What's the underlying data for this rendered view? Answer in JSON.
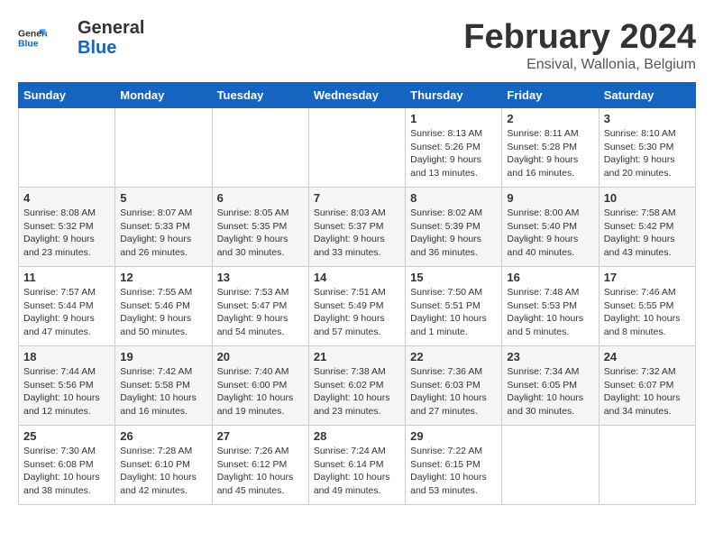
{
  "header": {
    "logo_general": "General",
    "logo_blue": "Blue",
    "month_title": "February 2024",
    "location": "Ensival, Wallonia, Belgium"
  },
  "weekdays": [
    "Sunday",
    "Monday",
    "Tuesday",
    "Wednesday",
    "Thursday",
    "Friday",
    "Saturday"
  ],
  "weeks": [
    [
      {
        "day": "",
        "info": ""
      },
      {
        "day": "",
        "info": ""
      },
      {
        "day": "",
        "info": ""
      },
      {
        "day": "",
        "info": ""
      },
      {
        "day": "1",
        "info": "Sunrise: 8:13 AM\nSunset: 5:26 PM\nDaylight: 9 hours\nand 13 minutes."
      },
      {
        "day": "2",
        "info": "Sunrise: 8:11 AM\nSunset: 5:28 PM\nDaylight: 9 hours\nand 16 minutes."
      },
      {
        "day": "3",
        "info": "Sunrise: 8:10 AM\nSunset: 5:30 PM\nDaylight: 9 hours\nand 20 minutes."
      }
    ],
    [
      {
        "day": "4",
        "info": "Sunrise: 8:08 AM\nSunset: 5:32 PM\nDaylight: 9 hours\nand 23 minutes."
      },
      {
        "day": "5",
        "info": "Sunrise: 8:07 AM\nSunset: 5:33 PM\nDaylight: 9 hours\nand 26 minutes."
      },
      {
        "day": "6",
        "info": "Sunrise: 8:05 AM\nSunset: 5:35 PM\nDaylight: 9 hours\nand 30 minutes."
      },
      {
        "day": "7",
        "info": "Sunrise: 8:03 AM\nSunset: 5:37 PM\nDaylight: 9 hours\nand 33 minutes."
      },
      {
        "day": "8",
        "info": "Sunrise: 8:02 AM\nSunset: 5:39 PM\nDaylight: 9 hours\nand 36 minutes."
      },
      {
        "day": "9",
        "info": "Sunrise: 8:00 AM\nSunset: 5:40 PM\nDaylight: 9 hours\nand 40 minutes."
      },
      {
        "day": "10",
        "info": "Sunrise: 7:58 AM\nSunset: 5:42 PM\nDaylight: 9 hours\nand 43 minutes."
      }
    ],
    [
      {
        "day": "11",
        "info": "Sunrise: 7:57 AM\nSunset: 5:44 PM\nDaylight: 9 hours\nand 47 minutes."
      },
      {
        "day": "12",
        "info": "Sunrise: 7:55 AM\nSunset: 5:46 PM\nDaylight: 9 hours\nand 50 minutes."
      },
      {
        "day": "13",
        "info": "Sunrise: 7:53 AM\nSunset: 5:47 PM\nDaylight: 9 hours\nand 54 minutes."
      },
      {
        "day": "14",
        "info": "Sunrise: 7:51 AM\nSunset: 5:49 PM\nDaylight: 9 hours\nand 57 minutes."
      },
      {
        "day": "15",
        "info": "Sunrise: 7:50 AM\nSunset: 5:51 PM\nDaylight: 10 hours\nand 1 minute."
      },
      {
        "day": "16",
        "info": "Sunrise: 7:48 AM\nSunset: 5:53 PM\nDaylight: 10 hours\nand 5 minutes."
      },
      {
        "day": "17",
        "info": "Sunrise: 7:46 AM\nSunset: 5:55 PM\nDaylight: 10 hours\nand 8 minutes."
      }
    ],
    [
      {
        "day": "18",
        "info": "Sunrise: 7:44 AM\nSunset: 5:56 PM\nDaylight: 10 hours\nand 12 minutes."
      },
      {
        "day": "19",
        "info": "Sunrise: 7:42 AM\nSunset: 5:58 PM\nDaylight: 10 hours\nand 16 minutes."
      },
      {
        "day": "20",
        "info": "Sunrise: 7:40 AM\nSunset: 6:00 PM\nDaylight: 10 hours\nand 19 minutes."
      },
      {
        "day": "21",
        "info": "Sunrise: 7:38 AM\nSunset: 6:02 PM\nDaylight: 10 hours\nand 23 minutes."
      },
      {
        "day": "22",
        "info": "Sunrise: 7:36 AM\nSunset: 6:03 PM\nDaylight: 10 hours\nand 27 minutes."
      },
      {
        "day": "23",
        "info": "Sunrise: 7:34 AM\nSunset: 6:05 PM\nDaylight: 10 hours\nand 30 minutes."
      },
      {
        "day": "24",
        "info": "Sunrise: 7:32 AM\nSunset: 6:07 PM\nDaylight: 10 hours\nand 34 minutes."
      }
    ],
    [
      {
        "day": "25",
        "info": "Sunrise: 7:30 AM\nSunset: 6:08 PM\nDaylight: 10 hours\nand 38 minutes."
      },
      {
        "day": "26",
        "info": "Sunrise: 7:28 AM\nSunset: 6:10 PM\nDaylight: 10 hours\nand 42 minutes."
      },
      {
        "day": "27",
        "info": "Sunrise: 7:26 AM\nSunset: 6:12 PM\nDaylight: 10 hours\nand 45 minutes."
      },
      {
        "day": "28",
        "info": "Sunrise: 7:24 AM\nSunset: 6:14 PM\nDaylight: 10 hours\nand 49 minutes."
      },
      {
        "day": "29",
        "info": "Sunrise: 7:22 AM\nSunset: 6:15 PM\nDaylight: 10 hours\nand 53 minutes."
      },
      {
        "day": "",
        "info": ""
      },
      {
        "day": "",
        "info": ""
      }
    ]
  ]
}
